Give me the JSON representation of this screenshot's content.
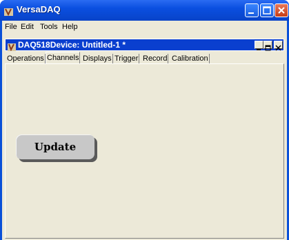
{
  "window": {
    "title": "VersaDAQ"
  },
  "menu": [
    "File",
    "Edit",
    "Tools",
    "Help"
  ],
  "document": {
    "title": "DAQ518Device: Untitled-1 *",
    "tabs": [
      "Operations",
      "Channels",
      "Displays",
      "Trigger",
      "Record",
      "Calibration"
    ],
    "active_tab": "Channels"
  },
  "update_button": {
    "label": "Update"
  },
  "colors": {
    "titlebar": "#0a50d8",
    "inner_titlebar": "#0a3fcf",
    "panel": "#ece9d8"
  }
}
